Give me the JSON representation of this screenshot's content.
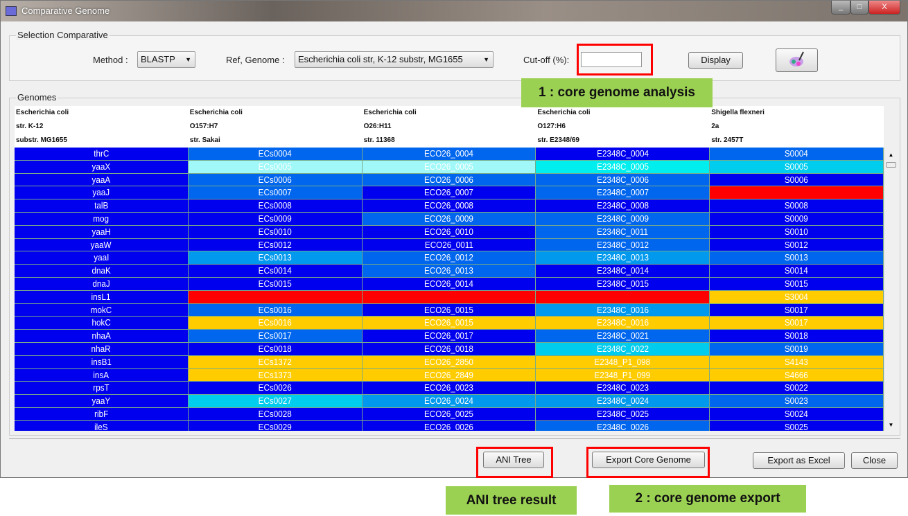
{
  "window": {
    "title": "Comparative Genome",
    "min": "_",
    "max": "□",
    "close": "X"
  },
  "selection": {
    "group_label": "Selection Comparative",
    "method_label": "Method :",
    "method_value": "BLASTP",
    "ref_label": "Ref, Genome :",
    "ref_value": "Escherichia coli str, K-12 substr, MG1655",
    "cutoff_label": "Cut-off (%):",
    "cutoff_value": "",
    "display_button": "Display",
    "paint_icon": "paint-brush-icon"
  },
  "genomes": {
    "group_label": "Genomes",
    "columns": [
      [
        "Escherichia coli",
        "str. K-12",
        "substr. MG1655"
      ],
      [
        "Escherichia coli",
        "O157:H7",
        "str. Sakai"
      ],
      [
        "Escherichia coli",
        "O26:H11",
        "str. 11368"
      ],
      [
        "Escherichia coli",
        "O127:H6",
        "str. E2348/69"
      ],
      [
        "Shigella flexneri",
        "2a",
        "str. 2457T"
      ]
    ],
    "colors": {
      "D": "#0000ee",
      "M": "#0066ee",
      "S": "#0099ee",
      "C": "#00ccee",
      "T": "#00eeee",
      "P": "#a0f8f8",
      "R": "#ff0000",
      "Y": "#ffcc00"
    },
    "rows": [
      {
        "gene": "thrC",
        "cells": [
          "ECs0004",
          "ECO26_0004",
          "E2348C_0004",
          "S0004"
        ],
        "c": [
          "M",
          "M",
          "D",
          "M"
        ]
      },
      {
        "gene": "yaaX",
        "cells": [
          "ECs0005",
          "ECO26_0005",
          "E2348C_0005",
          "S0005"
        ],
        "c": [
          "P",
          "P",
          "T",
          "C"
        ]
      },
      {
        "gene": "yaaA",
        "cells": [
          "ECs0006",
          "ECO26_0006",
          "E2348C_0006",
          "S0006"
        ],
        "c": [
          "M",
          "M",
          "M",
          "D"
        ]
      },
      {
        "gene": "yaaJ",
        "cells": [
          "ECs0007",
          "ECO26_0007",
          "E2348C_0007",
          ""
        ],
        "c": [
          "M",
          "D",
          "M",
          "R"
        ]
      },
      {
        "gene": "talB",
        "cells": [
          "ECs0008",
          "ECO26_0008",
          "E2348C_0008",
          "S0008"
        ],
        "c": [
          "D",
          "D",
          "D",
          "D"
        ]
      },
      {
        "gene": "mog",
        "cells": [
          "ECs0009",
          "ECO26_0009",
          "E2348C_0009",
          "S0009"
        ],
        "c": [
          "D",
          "M",
          "M",
          "D"
        ]
      },
      {
        "gene": "yaaH",
        "cells": [
          "ECs0010",
          "ECO26_0010",
          "E2348C_0011",
          "S0010"
        ],
        "c": [
          "D",
          "D",
          "M",
          "D"
        ]
      },
      {
        "gene": "yaaW",
        "cells": [
          "ECs0012",
          "ECO26_0011",
          "E2348C_0012",
          "S0012"
        ],
        "c": [
          "D",
          "D",
          "M",
          "D"
        ]
      },
      {
        "gene": "yaaI",
        "cells": [
          "ECs0013",
          "ECO26_0012",
          "E2348C_0013",
          "S0013"
        ],
        "c": [
          "S",
          "M",
          "S",
          "M"
        ]
      },
      {
        "gene": "dnaK",
        "cells": [
          "ECs0014",
          "ECO26_0013",
          "E2348C_0014",
          "S0014"
        ],
        "c": [
          "D",
          "M",
          "D",
          "D"
        ]
      },
      {
        "gene": "dnaJ",
        "cells": [
          "ECs0015",
          "ECO26_0014",
          "E2348C_0015",
          "S0015"
        ],
        "c": [
          "D",
          "D",
          "D",
          "D"
        ]
      },
      {
        "gene": "insL1",
        "cells": [
          "",
          "",
          "",
          "S3004"
        ],
        "c": [
          "R",
          "R",
          "R",
          "Y"
        ]
      },
      {
        "gene": "mokC",
        "cells": [
          "ECs0016",
          "ECO26_0015",
          "E2348C_0016",
          "S0017"
        ],
        "c": [
          "M",
          "D",
          "S",
          "D"
        ]
      },
      {
        "gene": "hokC",
        "cells": [
          "ECs0016",
          "ECO26_0015",
          "E2348C_0016",
          "S0017"
        ],
        "c": [
          "Y",
          "Y",
          "Y",
          "Y"
        ]
      },
      {
        "gene": "nhaA",
        "cells": [
          "ECs0017",
          "ECO26_0017",
          "E2348C_0021",
          "S0018"
        ],
        "c": [
          "M",
          "D",
          "M",
          "D"
        ]
      },
      {
        "gene": "nhaR",
        "cells": [
          "ECs0018",
          "ECO26_0018",
          "E2348C_0022",
          "S0019"
        ],
        "c": [
          "D",
          "D",
          "C",
          "M"
        ]
      },
      {
        "gene": "insB1",
        "cells": [
          "ECs1372",
          "ECO26_2850",
          "E2348_P1_098",
          "S4143"
        ],
        "c": [
          "Y",
          "Y",
          "Y",
          "Y"
        ]
      },
      {
        "gene": "insA",
        "cells": [
          "ECs1373",
          "ECO26_2849",
          "E2348_P1_099",
          "S4666"
        ],
        "c": [
          "Y",
          "Y",
          "Y",
          "Y"
        ]
      },
      {
        "gene": "rpsT",
        "cells": [
          "ECs0026",
          "ECO26_0023",
          "E2348C_0023",
          "S0022"
        ],
        "c": [
          "D",
          "D",
          "D",
          "D"
        ]
      },
      {
        "gene": "yaaY",
        "cells": [
          "ECs0027",
          "ECO26_0024",
          "E2348C_0024",
          "S0023"
        ],
        "c": [
          "C",
          "S",
          "S",
          "M"
        ]
      },
      {
        "gene": "ribF",
        "cells": [
          "ECs0028",
          "ECO26_0025",
          "E2348C_0025",
          "S0024"
        ],
        "c": [
          "D",
          "D",
          "D",
          "D"
        ]
      },
      {
        "gene": "ileS",
        "cells": [
          "ECs0029",
          "ECO26_0026",
          "E2348C_0026",
          "S0025"
        ],
        "c": [
          "D",
          "D",
          "M",
          "D"
        ]
      }
    ]
  },
  "footer": {
    "ani_tree": "ANI Tree",
    "export_core": "Export Core Genome",
    "export_excel": "Export as Excel",
    "close": "Close"
  },
  "annotations": {
    "core_analysis": "1 : core genome analysis",
    "ani_result": "ANI tree result",
    "core_export": "2 : core genome export"
  }
}
